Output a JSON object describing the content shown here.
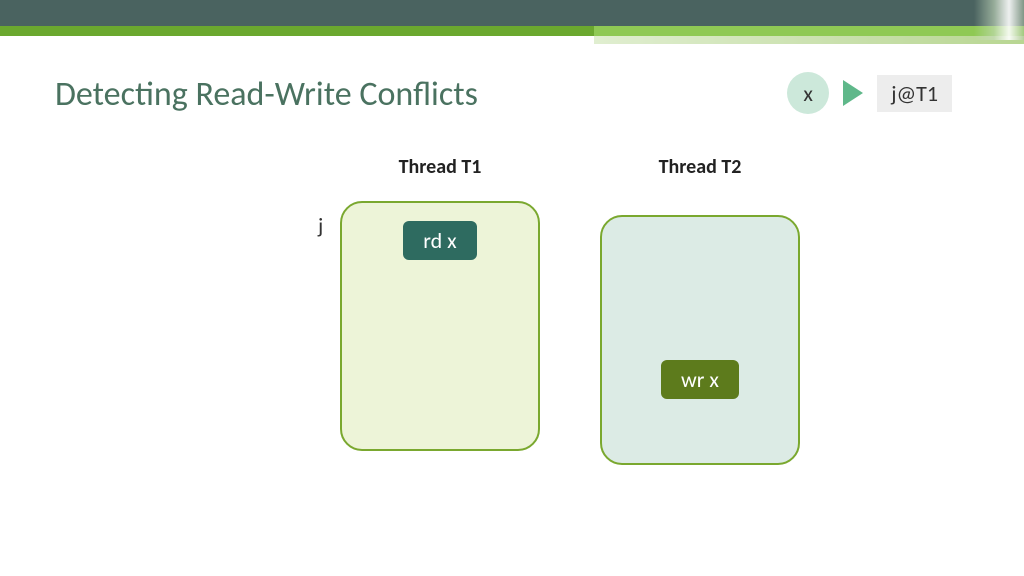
{
  "title": "Detecting Read-Write Conflicts",
  "badge": {
    "variable": "x",
    "tag": "j@T1"
  },
  "threads": {
    "t1": {
      "label": "Thread T1",
      "sideLabel": "j",
      "op": "rd x"
    },
    "t2": {
      "label": "Thread T2",
      "op": "wr x"
    }
  }
}
